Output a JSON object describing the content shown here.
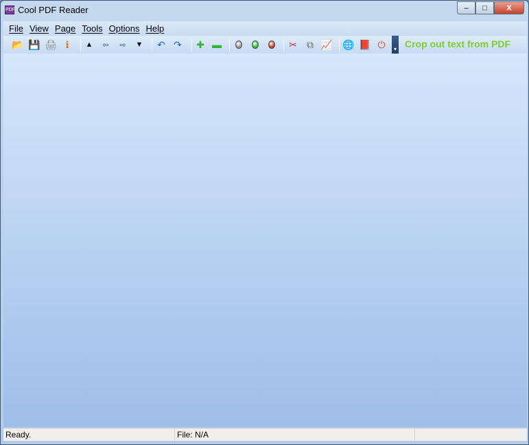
{
  "window": {
    "title": "Cool PDF Reader",
    "app_icon": "PDF",
    "controls": {
      "minimize": "–",
      "maximize": "□",
      "close": "X"
    }
  },
  "menu": [
    "File",
    "View",
    "Page",
    "Tools",
    "Options",
    "Help"
  ],
  "toolbar": {
    "buttons": [
      {
        "name": "open-icon",
        "glyph": "📂"
      },
      {
        "name": "save-icon",
        "glyph": "💾"
      },
      {
        "name": "print-icon",
        "glyph": "🖨"
      },
      {
        "name": "info-icon",
        "glyph": "ℹ"
      },
      {
        "name": "first-page-icon",
        "glyph": "▲"
      },
      {
        "name": "previous-page-icon",
        "glyph": "⇦"
      },
      {
        "name": "next-page-icon",
        "glyph": "⇨"
      },
      {
        "name": "last-page-icon",
        "glyph": "▼"
      },
      {
        "name": "undo-icon",
        "glyph": "↶"
      },
      {
        "name": "redo-icon",
        "glyph": "↷"
      },
      {
        "name": "zoom-in-icon",
        "glyph": "✚"
      },
      {
        "name": "zoom-out-icon",
        "glyph": "▬"
      },
      {
        "name": "gray-light-icon",
        "glyph": ""
      },
      {
        "name": "green-light-icon",
        "glyph": ""
      },
      {
        "name": "red-light-icon",
        "glyph": ""
      },
      {
        "name": "scissors-icon",
        "glyph": "✂"
      },
      {
        "name": "copy-icon",
        "glyph": "⧉"
      },
      {
        "name": "chart-icon",
        "glyph": "📈"
      },
      {
        "name": "globe-icon",
        "glyph": "🌐"
      },
      {
        "name": "help-book-icon",
        "glyph": "📕"
      },
      {
        "name": "power-icon",
        "glyph": "⏻"
      }
    ],
    "promo_text": "Crop out text from PDF"
  },
  "status": {
    "message": "Ready.",
    "file": "File: N/A"
  }
}
